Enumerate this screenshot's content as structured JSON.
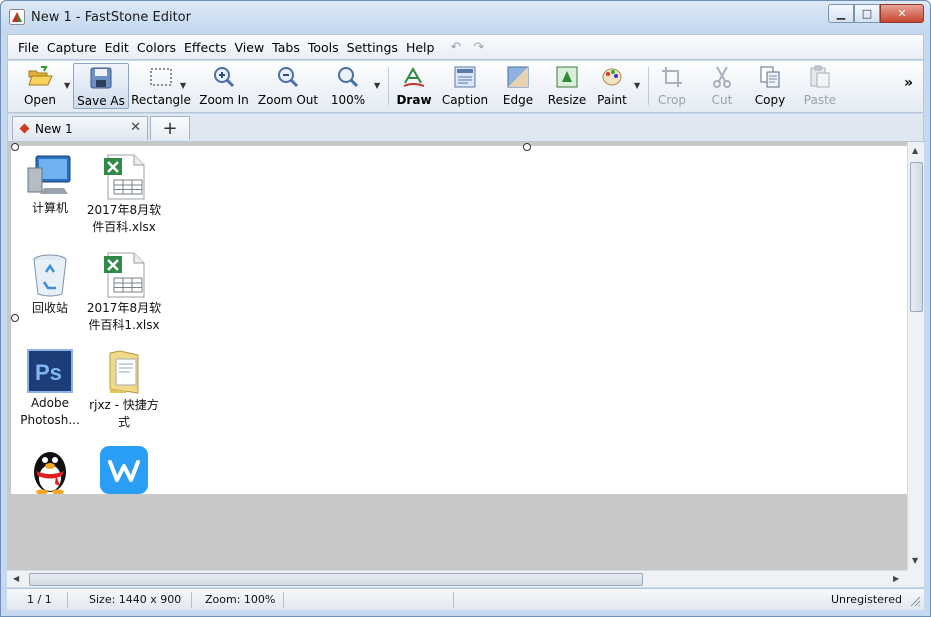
{
  "window": {
    "title": "New 1 - FastStone Editor",
    "buttons": {
      "minimize": "▁",
      "maximize": "□",
      "close": "✕"
    }
  },
  "menu": {
    "items": [
      "File",
      "Capture",
      "Edit",
      "Colors",
      "Effects",
      "View",
      "Tabs",
      "Tools",
      "Settings",
      "Help"
    ],
    "undo": "↶",
    "redo": "↷"
  },
  "toolbar": {
    "open": "Open",
    "save_as": "Save As",
    "rectangle": "Rectangle",
    "zoom_in": "Zoom In",
    "zoom_out": "Zoom Out",
    "zoom_level": "100%",
    "draw": "Draw",
    "caption": "Caption",
    "edge": "Edge",
    "resize": "Resize",
    "paint": "Paint",
    "crop": "Crop",
    "cut": "Cut",
    "copy": "Copy",
    "paste": "Paste",
    "more": "»"
  },
  "tabs": {
    "active": "New 1",
    "close": "✕",
    "add": "+"
  },
  "desktop_icons": [
    {
      "label": "计算机",
      "icon": "computer-icon"
    },
    {
      "label": "2017年8月软件百科.xlsx",
      "icon": "excel-file-icon"
    },
    {
      "label": "回收站",
      "icon": "recycle-bin-icon"
    },
    {
      "label": "2017年8月软件百科1.xlsx",
      "icon": "excel-file-icon"
    },
    {
      "label": "Adobe Photosh...",
      "icon": "photoshop-icon"
    },
    {
      "label": "rjxz - 快捷方式",
      "icon": "folder-shortcut-icon"
    },
    {
      "label": "",
      "icon": "qq-penguin-icon"
    },
    {
      "label": "",
      "icon": "wps-office-icon"
    }
  ],
  "status": {
    "page": "1 / 1",
    "size": "Size: 1440 x 900",
    "zoom": "Zoom: 100%",
    "registration": "Unregistered"
  }
}
